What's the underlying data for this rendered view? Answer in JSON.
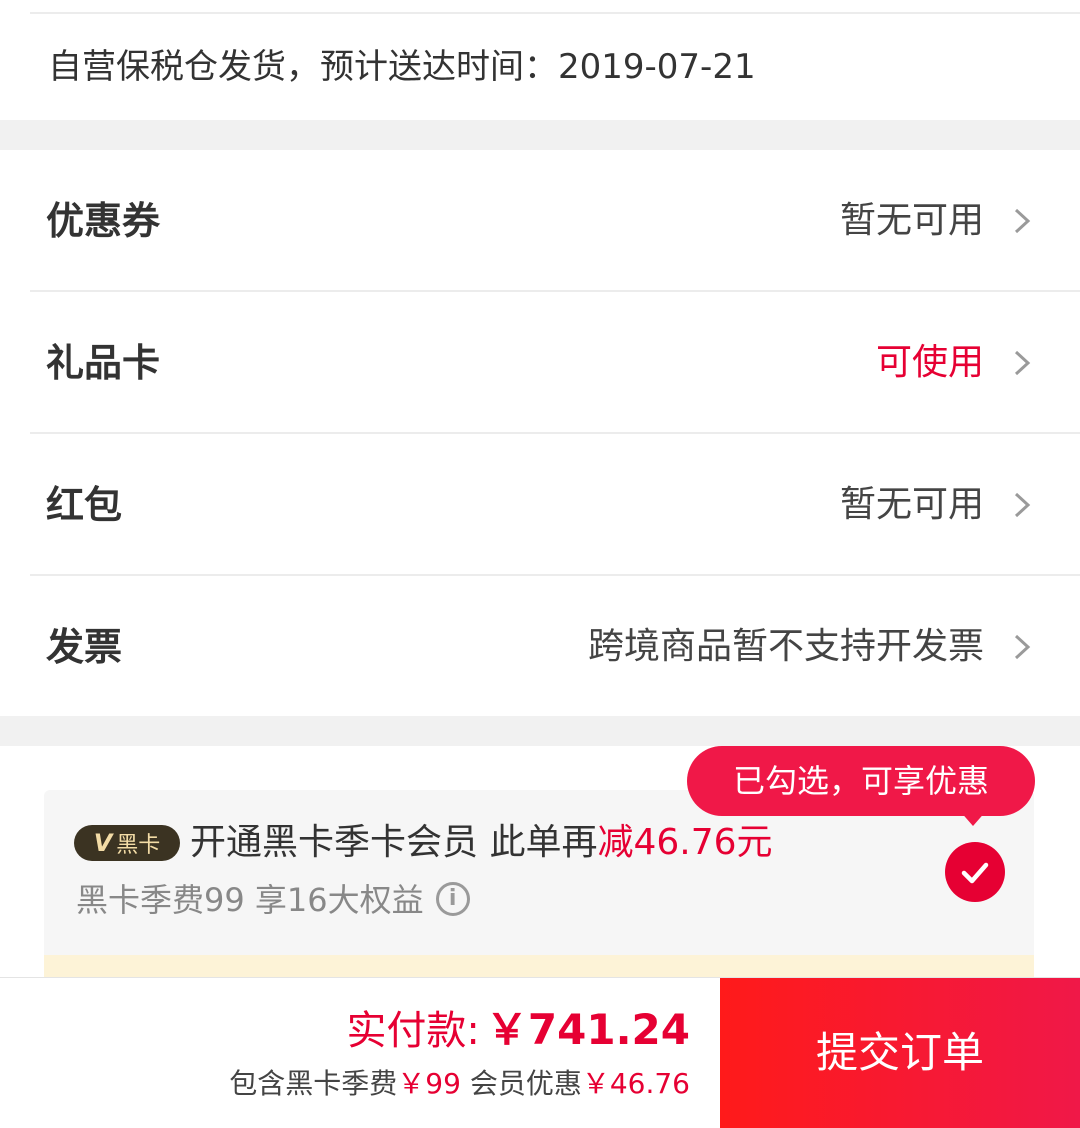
{
  "shipping": {
    "text": "自营保税仓发货，预计送达时间：2019-07-21"
  },
  "options": [
    {
      "label": "优惠券",
      "value": "暂无可用",
      "value_color": "#444444"
    },
    {
      "label": "礼品卡",
      "value": "可使用",
      "value_color": "#e60033"
    },
    {
      "label": "红包",
      "value": "暂无可用",
      "value_color": "#444444"
    },
    {
      "label": "发票",
      "value": "跨境商品暂不支持开发票",
      "value_color": "#444444"
    }
  ],
  "member": {
    "badge_v": "V",
    "badge_text": "黑卡",
    "title_main": "开通黑卡季卡会员 此单再",
    "title_discount": "减46.76元",
    "subtitle": "黑卡季费99 享16大权益",
    "info_glyph": "i",
    "tooltip": "已勾选，可享优惠",
    "checked": true
  },
  "footer": {
    "pay_label": "实付款:",
    "pay_amount": "￥741.24",
    "detail_prefix": "包含黑卡季费",
    "detail_fee": "￥99",
    "detail_middle": " 会员优惠",
    "detail_discount": "￥46.76",
    "submit_label": "提交订单"
  },
  "colors": {
    "accent": "#e60033",
    "button": "#ff1a1a",
    "badge_bg": "#3b3322",
    "badge_text": "#f3dca6"
  }
}
